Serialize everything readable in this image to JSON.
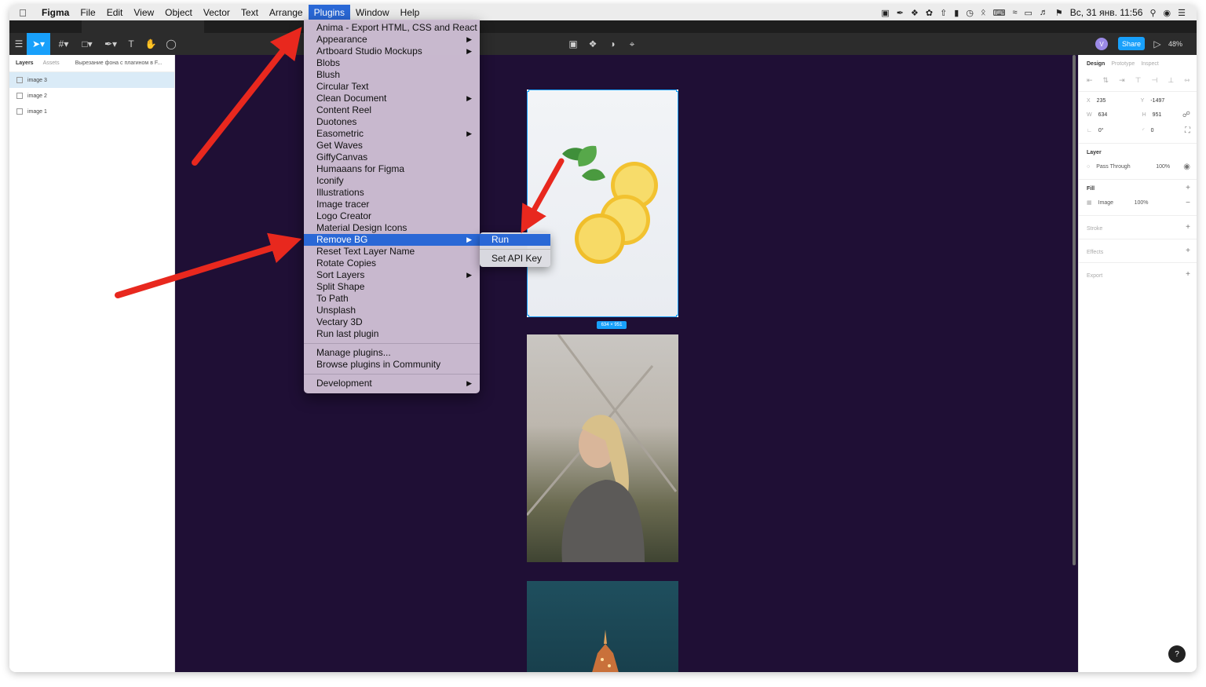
{
  "menubar": {
    "app_name": "Figma",
    "items": [
      "File",
      "Edit",
      "View",
      "Object",
      "Vector",
      "Text",
      "Arrange",
      "Plugins",
      "Window",
      "Help"
    ],
    "active_item": "Plugins",
    "clock": "Вс, 31 янв. 11:56"
  },
  "toolbar": {
    "share_label": "Share",
    "avatar_initial": "V",
    "zoom": "48%"
  },
  "left_panel": {
    "tabs": [
      "Layers",
      "Assets"
    ],
    "page_name": "Вырезание фона с плагином в F...",
    "layers": [
      "image 3",
      "image 2",
      "image 1"
    ]
  },
  "canvas": {
    "size_badge": "634 × 951"
  },
  "right_panel": {
    "tabs": [
      "Design",
      "Prototype",
      "Inspect"
    ],
    "x_label": "X",
    "x_value": "235",
    "y_label": "Y",
    "y_value": "-1497",
    "w_label": "W",
    "w_value": "634",
    "h_label": "H",
    "h_value": "951",
    "rotation": "0°",
    "radius": "0",
    "layer_title": "Layer",
    "blend_mode": "Pass Through",
    "layer_opacity": "100%",
    "fill_title": "Fill",
    "fill_type": "Image",
    "fill_opacity": "100%",
    "stroke_title": "Stroke",
    "effects_title": "Effects",
    "export_title": "Export"
  },
  "plugins_menu": {
    "items": [
      {
        "label": "Anima - Export HTML, CSS and React",
        "submenu": false
      },
      {
        "label": "Appearance",
        "submenu": true
      },
      {
        "label": "Artboard Studio Mockups",
        "submenu": true
      },
      {
        "label": "Blobs",
        "submenu": false
      },
      {
        "label": "Blush",
        "submenu": false
      },
      {
        "label": "Circular Text",
        "submenu": false
      },
      {
        "label": "Clean Document",
        "submenu": true
      },
      {
        "label": "Content Reel",
        "submenu": false
      },
      {
        "label": "Duotones",
        "submenu": false
      },
      {
        "label": "Easometric",
        "submenu": true
      },
      {
        "label": "Get Waves",
        "submenu": false
      },
      {
        "label": "GiffyCanvas",
        "submenu": false
      },
      {
        "label": "Humaaans for Figma",
        "submenu": false
      },
      {
        "label": "Iconify",
        "submenu": false
      },
      {
        "label": "Illustrations",
        "submenu": false
      },
      {
        "label": "Image tracer",
        "submenu": false
      },
      {
        "label": "Logo Creator",
        "submenu": false
      },
      {
        "label": "Material Design Icons",
        "submenu": false
      },
      {
        "label": "Remove BG",
        "submenu": true,
        "highlighted": true
      },
      {
        "label": "Reset Text Layer Name",
        "submenu": false
      },
      {
        "label": "Rotate Copies",
        "submenu": false
      },
      {
        "label": "Sort Layers",
        "submenu": true
      },
      {
        "label": "Split Shape",
        "submenu": false
      },
      {
        "label": "To Path",
        "submenu": false
      },
      {
        "label": "Unsplash",
        "submenu": false
      },
      {
        "label": "Vectary 3D",
        "submenu": false
      },
      {
        "label": "Run last plugin",
        "submenu": false
      }
    ],
    "manage": "Manage plugins...",
    "browse": "Browse plugins in Community",
    "development": "Development"
  },
  "submenu": {
    "run": "Run",
    "set_api_key": "Set API Key"
  },
  "colors": {
    "accent": "#18a0fb",
    "menu_highlight": "#2a68d6",
    "canvas_bg": "#1f0f35",
    "annotation_arrow": "#e8281e"
  }
}
